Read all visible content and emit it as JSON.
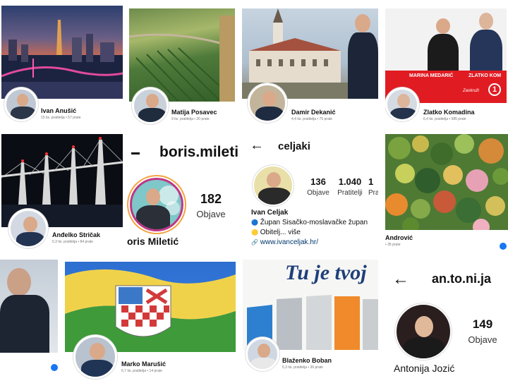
{
  "tiles": {
    "ivan_anusic": {
      "name": "Ivan Anušić",
      "meta": "15 tis. pratitelja • 57 prate"
    },
    "matija_posavec": {
      "name": "Matija Posavec",
      "meta": "9 tis. pratitelja • 20 prate"
    },
    "damir_dekanic": {
      "name": "Damir Dekanić",
      "meta": "4,4 tis. pratitelja • 75 prate"
    },
    "zlatko_komadina": {
      "name": "Zlatko Komadina",
      "meta": "6,4 tis. pratitelja • 585 prate",
      "banner_left": "MARINA MEDARIĆ",
      "banner_right": "ZLATKO KOM",
      "banner_tag": "Zaokruži",
      "banner_number": "1"
    },
    "andjelko_stricak": {
      "name": "Anđelko Stričak",
      "meta": "6,3 tis. pratitelja • 84 prate"
    },
    "boris_miletic": {
      "handle": "boris.mileti",
      "name": "oris Miletić",
      "posts": "182",
      "posts_label": "Objave"
    },
    "celjaki": {
      "handle": "celjaki",
      "name": "Ivan Celjak",
      "stats": [
        {
          "num": "136",
          "label": "Objave"
        },
        {
          "num": "1.040",
          "label": "Pratitelji"
        },
        {
          "num": "1",
          "label": "Pra"
        }
      ],
      "bio_line1": "Župan Sisačko-moslavačke župan",
      "bio_line2": "Obitelj... više",
      "link": "www.ivanceljak.hr/"
    },
    "androvic": {
      "name": "Andrović",
      "meta": "• 35 prate"
    },
    "marko_marusic": {
      "name": "Marko Marušić",
      "meta": "6,7 tis. pratitelja • 14 prate"
    },
    "blazenko_boban": {
      "name": "Blaženko Boban",
      "meta": "5,3 tis. pratitelja • 36 prate",
      "headline": "Tu je tvoj"
    },
    "antonija_jozic": {
      "handle": "an.to.ni.ja",
      "name": "Antonija Jozić",
      "posts": "149",
      "posts_label": "Objave"
    }
  },
  "icons": {
    "back": "←",
    "globe": "🔵",
    "family": "🟡",
    "link": "🔗"
  },
  "colors": {
    "facebook_blue": "#1877f2",
    "sdp_red": "#e11b22",
    "ig_gradient": "#c13584"
  }
}
